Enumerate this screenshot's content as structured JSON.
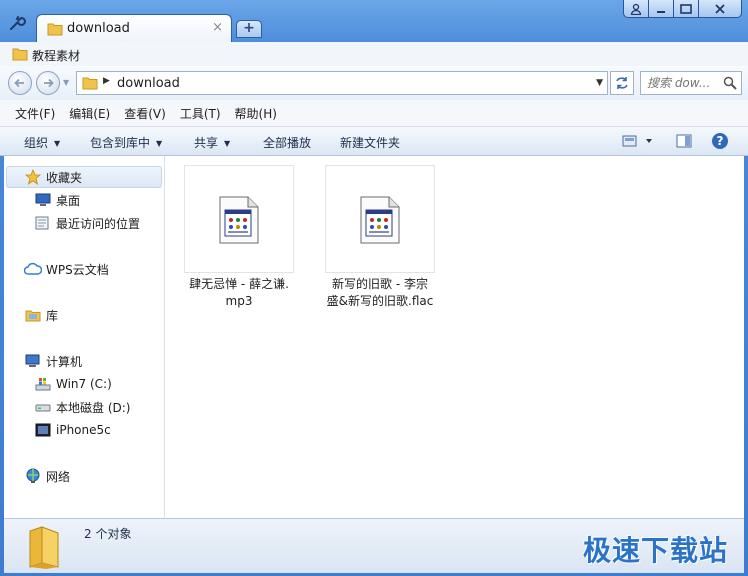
{
  "tab": {
    "title": "download",
    "close": "×",
    "new_tab": "+"
  },
  "bookmarks": [
    {
      "label": "教程素材"
    }
  ],
  "address": {
    "path": "download"
  },
  "search": {
    "placeholder": "搜索 dow..."
  },
  "menu": [
    "文件(F)",
    "编辑(E)",
    "查看(V)",
    "工具(T)",
    "帮助(H)"
  ],
  "commands": {
    "organize": "组织",
    "include": "包含到库中",
    "share": "共享",
    "play_all": "全部播放",
    "new_folder": "新建文件夹"
  },
  "nav": {
    "favorites": "收藏夹",
    "desktop": "桌面",
    "recent": "最近访问的位置",
    "wps": "WPS云文档",
    "library": "库",
    "computer": "计算机",
    "drive_c": "Win7 (C:)",
    "drive_d": "本地磁盘 (D:)",
    "iphone": "iPhone5c",
    "network": "网络"
  },
  "files": [
    {
      "name_line1": "肆无忌惮 - 薛之谦.",
      "name_line2": "mp3"
    },
    {
      "name_line1": "新写的旧歌 - 李宗",
      "name_line2": "盛&新写的旧歌.flac"
    }
  ],
  "status": {
    "count": "2 个对象"
  },
  "watermark": "极速下载站",
  "colors": {
    "accent": "#3d7cd0",
    "folder": "#f0c44c",
    "watermark": "#2b73c9"
  }
}
